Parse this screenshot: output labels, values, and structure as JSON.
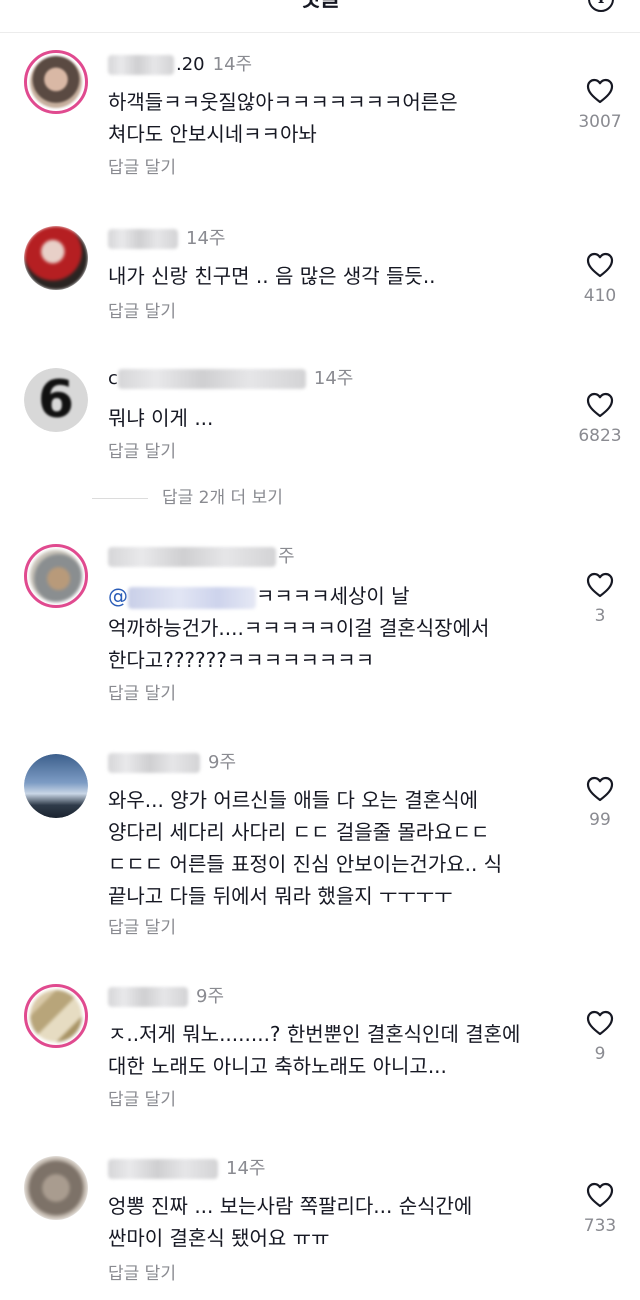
{
  "header": {
    "title": "댓글"
  },
  "comments": [
    {
      "name_suffix": ".20",
      "time": "14주",
      "text": "하객들ㅋㅋ웃질않아ㅋㅋㅋㅋㅋㅋㅋ어른은\n쳐다도 안보시네ㅋㅋ아놔",
      "reply": "답글 달기",
      "likes": "3007"
    },
    {
      "time": "14주",
      "text": "내가 신랑 친구면 .. 음 많은 생각 들듯..",
      "reply": "답글 달기",
      "likes": "410"
    },
    {
      "name_prefix": "c",
      "time": "14주",
      "text": "뭐냐 이게 ...",
      "reply": "답글 달기",
      "likes": "6823"
    },
    {
      "time": "주",
      "mention": "@",
      "text_after_mention": "ㅋㅋㅋㅋ세상이 날",
      "text": "억까하능건가....ㅋㅋㅋㅋㅋ이걸 결혼식장에서\n한다고??????ㅋㅋㅋㅋㅋㅋㅋㅋ",
      "reply": "답글 달기",
      "likes": "3"
    },
    {
      "time": "9주",
      "text": "와우... 양가 어르신들 애들 다 오는 결혼식에\n양다리 세다리 사다리 ㄷㄷ  걸을줄 몰라요ㄷㄷ\nㄷㄷㄷ  어른들 표정이 진심 안보이는건가요.. 식\n끝나고 다들 뒤에서 뭐라 했을지 ㅜㅜㅜㅜ",
      "reply": "답글 달기",
      "likes": "99"
    },
    {
      "time": "9주",
      "text": "ㅈ..저게 뭐노........? 한번뿐인 결혼식인데 결혼에\n대한 노래도 아니고 축하노래도 아니고...",
      "reply": "답글 달기",
      "likes": "9"
    },
    {
      "time": "14주",
      "text": "엉뽕 진짜 ... 보는사람 쪽팔리다... 순식간에\n싼마이 결혼식 됐어요 ㅠㅠ",
      "reply": "답글 달기",
      "likes": "733"
    }
  ],
  "more_replies": "답글 2개 더 보기",
  "icons": {
    "like": "heart-outline-icon",
    "info": "info-icon"
  }
}
